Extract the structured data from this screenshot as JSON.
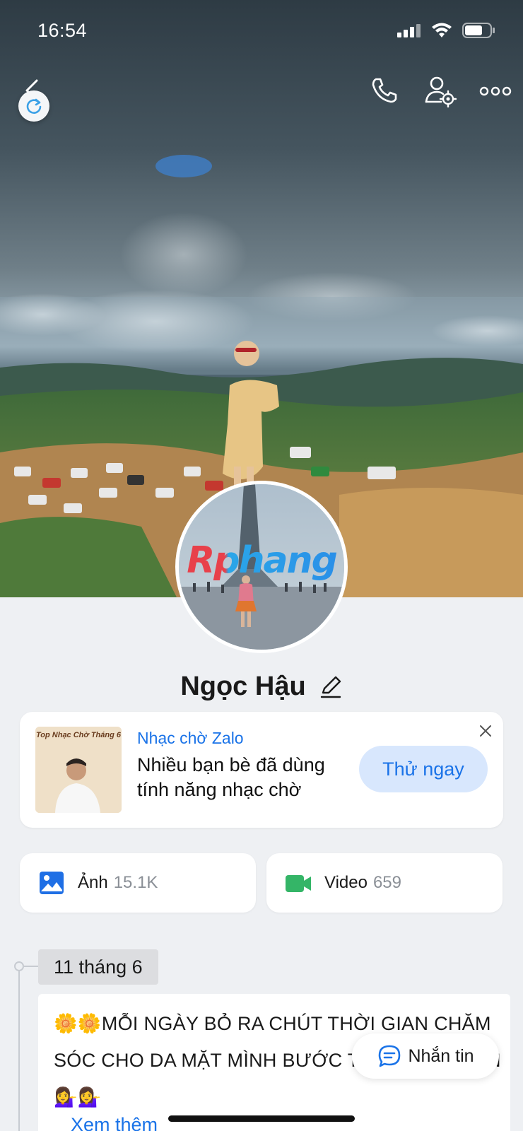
{
  "status_bar": {
    "time": "16:54"
  },
  "profile": {
    "name": "Ngọc Hậu",
    "avatar_watermark": "Rphang"
  },
  "promo": {
    "thumb_title": "Top Nhạc Chờ Tháng 6",
    "label": "Nhạc chờ Zalo",
    "description": "Nhiều bạn bè đã dùng tính năng nhạc chờ",
    "button": "Thử ngay"
  },
  "media": {
    "photos": {
      "label": "Ảnh",
      "count": "15.1K"
    },
    "videos": {
      "label": "Video",
      "count": "659"
    }
  },
  "timeline": {
    "date": "11 tháng 6",
    "post_text": "🌼🌼MỖI NGÀY BỎ RA CHÚT THỜI GIAN CHĂM SÓC CHO DA MẶT MÌNH BƯỚC THẬT ĐƠN GIẢN 💁‍♀️💁‍♀️",
    "see_more": "Xem thêm"
  },
  "message_button": "Nhắn tin",
  "colors": {
    "accent": "#1a73e8",
    "accent_soft": "#d8e7fd",
    "photo_icon": "#1f6fe5",
    "video_icon": "#34b567"
  },
  "icons": {
    "back": "chevron-left-icon",
    "refresh": "refresh-icon",
    "call": "phone-icon",
    "profile_settings": "user-gear-icon",
    "more": "more-horizontal-icon",
    "edit": "pencil-icon",
    "close": "close-icon",
    "photos": "image-icon",
    "videos": "video-camera-icon",
    "message": "chat-bubble-icon"
  }
}
